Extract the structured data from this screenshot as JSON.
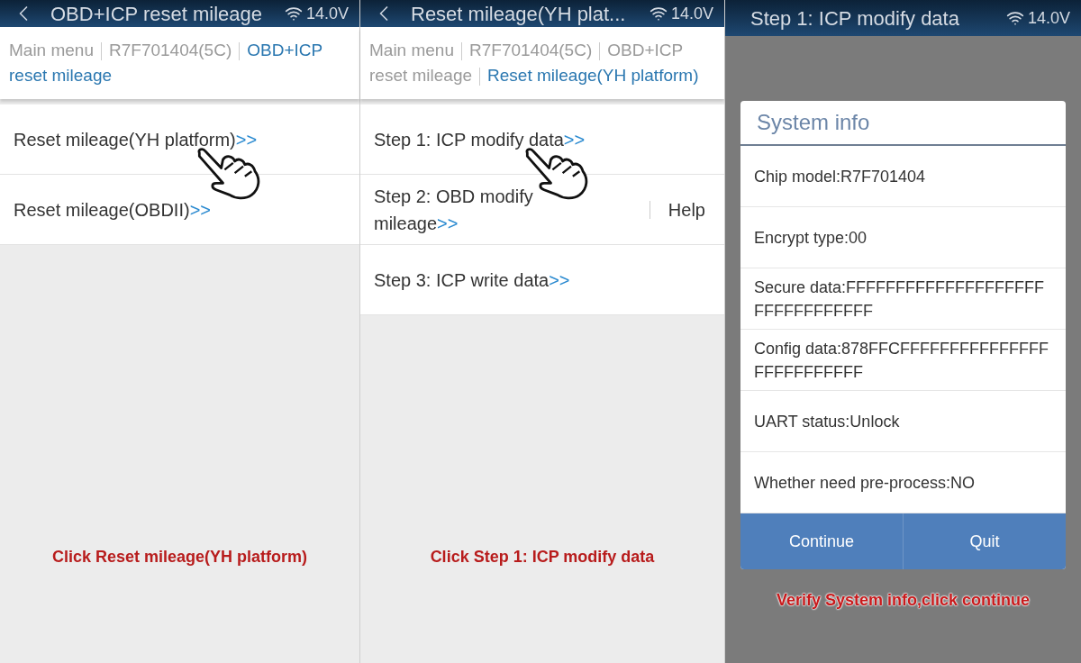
{
  "panels": [
    {
      "kind": "menu",
      "header": {
        "back": true,
        "title": "OBD+ICP reset mileage",
        "voltage": "14.0V"
      },
      "breadcrumb": [
        {
          "label": "Main menu",
          "selected": false
        },
        {
          "label": "R7F701404(5C)",
          "selected": false
        },
        {
          "label": "OBD+ICP reset mileage",
          "selected": true
        }
      ],
      "items": [
        {
          "label": "Reset mileage(YH platform)",
          "suffix": ">>",
          "pointer": true
        },
        {
          "label": "Reset mileage(OBDII)",
          "suffix": ">>",
          "pointer": false
        }
      ],
      "caption": "Click Reset mileage(YH platform)"
    },
    {
      "kind": "menu",
      "header": {
        "back": true,
        "title": "Reset mileage(YH plat...",
        "voltage": "14.0V"
      },
      "breadcrumb": [
        {
          "label": "Main menu",
          "selected": false
        },
        {
          "label": "R7F701404(5C)",
          "selected": false
        },
        {
          "label": "OBD+ICP reset mileage",
          "selected": false
        },
        {
          "label": "Reset mileage(YH platform)",
          "selected": true
        }
      ],
      "items": [
        {
          "label": "Step 1: ICP modify data",
          "suffix": ">>",
          "pointer": true
        },
        {
          "label": "Step 2: OBD modify mileage",
          "suffix": ">>",
          "pointer": false,
          "help": "Help"
        },
        {
          "label": "Step 3: ICP write data",
          "suffix": ">>",
          "pointer": false
        }
      ],
      "caption": "Click Step 1: ICP modify data"
    },
    {
      "kind": "dialog",
      "header": {
        "back": false,
        "title": "Step 1: ICP modify data",
        "voltage": "14.0V"
      },
      "dialog": {
        "title": "System info",
        "rows": [
          "Chip model:R7F701404",
          "Encrypt type:00",
          "Secure data:FFFFFFFFFFFFFFFFFFFFFFFFFFFFFFFF",
          "Config data:878FFCFFFFFFFFFFFFFFFFFFFFFFFFFF",
          "UART status:Unlock",
          "Whether need pre-process:NO"
        ],
        "buttons": [
          "Continue",
          "Quit"
        ]
      },
      "caption": "Verify System info,click continue"
    }
  ]
}
